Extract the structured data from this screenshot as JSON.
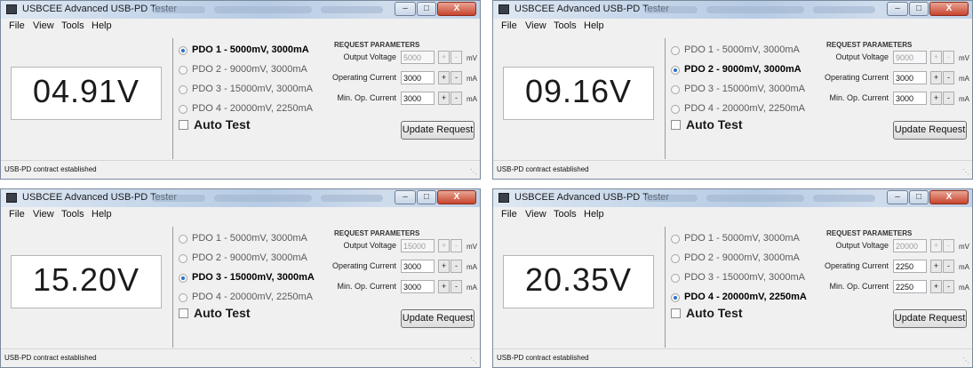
{
  "app": {
    "title": "USBCEE Advanced USB-PD Tester",
    "menus": [
      "File",
      "View",
      "Tools",
      "Help"
    ],
    "pdo_options": [
      "PDO 1 - 5000mV, 3000mA",
      "PDO 2 - 9000mV, 3000mA",
      "PDO 3 - 15000mV, 3000mA",
      "PDO 4 - 20000mV, 2250mA"
    ],
    "auto_test_label": "Auto Test",
    "request_parameters_title": "REQUEST PARAMETERS",
    "labels": {
      "output_voltage": "Output Voltage",
      "operating_current": "Operating Current",
      "min_op_current": "Min. Op. Current"
    },
    "units": {
      "voltage": "mV",
      "current": "mA"
    },
    "stepper": {
      "plus": "+",
      "minus": "-"
    },
    "update_button_label": "Update Request",
    "window_controls": {
      "minimize": "–",
      "maximize": "□",
      "close": "X"
    }
  },
  "windows": [
    {
      "voltage_display": "04.91V",
      "selected_pdo": 1,
      "output_voltage": "5000",
      "operating_current": "3000",
      "min_op_current": "3000",
      "status": "USB-PD contract established"
    },
    {
      "voltage_display": "09.16V",
      "selected_pdo": 2,
      "output_voltage": "9000",
      "operating_current": "3000",
      "min_op_current": "3000",
      "status": "USB-PD contract established"
    },
    {
      "voltage_display": "15.20V",
      "selected_pdo": 3,
      "output_voltage": "15000",
      "operating_current": "3000",
      "min_op_current": "3000",
      "status": "USB-PD contract established"
    },
    {
      "voltage_display": "20.35V",
      "selected_pdo": 4,
      "output_voltage": "20000",
      "operating_current": "2250",
      "min_op_current": "2250",
      "status": "USB-PD contract established"
    }
  ]
}
